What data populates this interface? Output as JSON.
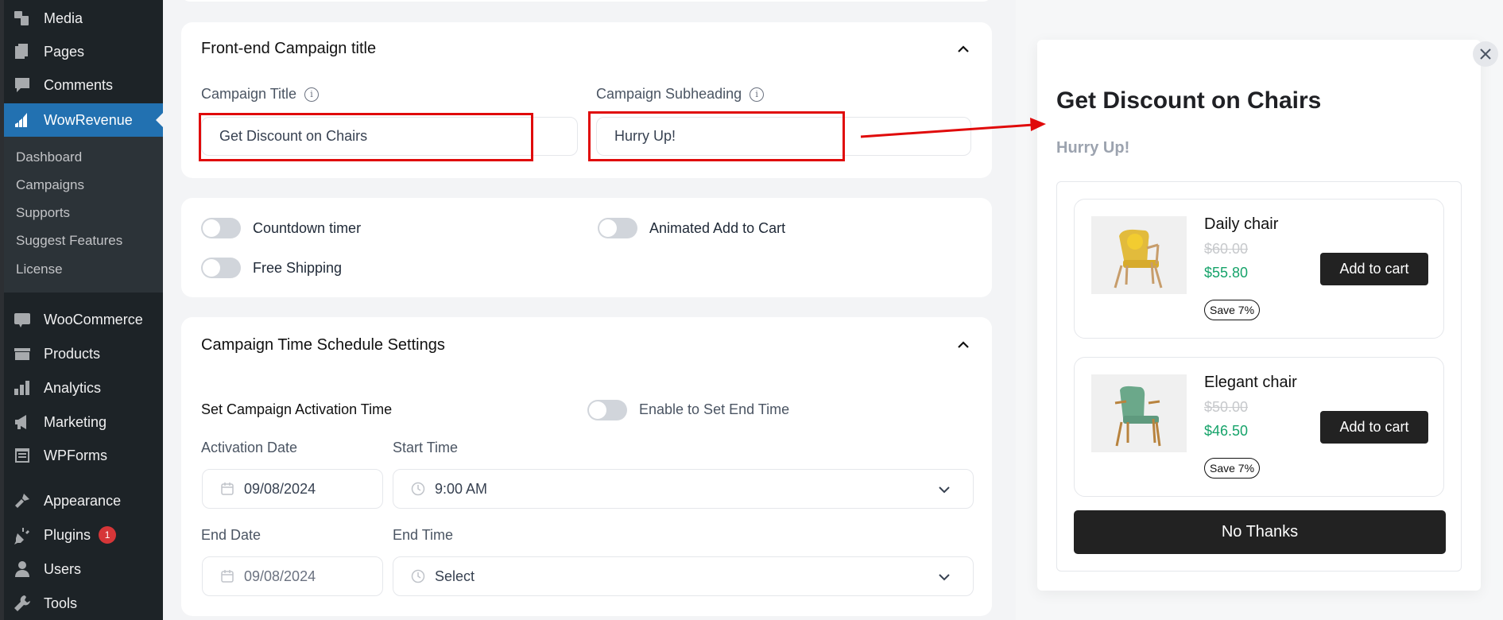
{
  "sidebar": {
    "items": [
      {
        "label": "Media",
        "icon": "media-icon"
      },
      {
        "label": "Pages",
        "icon": "pages-icon"
      },
      {
        "label": "Comments",
        "icon": "comments-icon"
      },
      {
        "label": "WowRevenue",
        "icon": "wowrevenue-icon",
        "active": true
      },
      {
        "label": "WooCommerce",
        "icon": "woocommerce-icon"
      },
      {
        "label": "Products",
        "icon": "products-icon"
      },
      {
        "label": "Analytics",
        "icon": "analytics-icon"
      },
      {
        "label": "Marketing",
        "icon": "marketing-icon"
      },
      {
        "label": "WPForms",
        "icon": "wpforms-icon"
      },
      {
        "label": "Appearance",
        "icon": "appearance-icon"
      },
      {
        "label": "Plugins",
        "icon": "plugins-icon",
        "badge": "1"
      },
      {
        "label": "Users",
        "icon": "users-icon"
      },
      {
        "label": "Tools",
        "icon": "tools-icon"
      }
    ],
    "submenu": [
      "Dashboard",
      "Campaigns",
      "Supports",
      "Suggest Features",
      "License"
    ],
    "accent": "#2271b1"
  },
  "title_section": {
    "heading": "Front-end Campaign title",
    "campaign_title_label": "Campaign Title",
    "campaign_title_value": "Get Discount on Chairs",
    "campaign_subheading_label": "Campaign Subheading",
    "campaign_subheading_value": "Hurry Up!"
  },
  "toggles": {
    "countdown_timer": "Countdown timer",
    "animated_add_to_cart": "Animated Add to Cart",
    "free_shipping": "Free Shipping"
  },
  "schedule": {
    "heading": "Campaign Time Schedule Settings",
    "activation_label": "Set Campaign Activation Time",
    "end_time_toggle": "Enable to Set End Time",
    "activation_date_label": "Activation Date",
    "activation_date_value": "09/08/2024",
    "start_time_label": "Start Time",
    "start_time_value": "9:00 AM",
    "end_date_label": "End Date",
    "end_date_value": "09/08/2024",
    "end_time_label": "End Time",
    "end_time_value": "Select"
  },
  "preview": {
    "title": "Get Discount on Chairs",
    "subtitle": "Hurry Up!",
    "products": [
      {
        "name": "Daily chair",
        "old_price": "$60.00",
        "new_price": "$55.80",
        "save": "Save 7%",
        "button": "Add to cart",
        "color": "#e2bb3c"
      },
      {
        "name": "Elegant chair",
        "old_price": "$50.00",
        "new_price": "$46.50",
        "save": "Save 7%",
        "button": "Add to cart",
        "color": "#6ba88a"
      }
    ],
    "no_thanks": "No Thanks",
    "price_color": "#16a36a"
  },
  "annotation_color": "#e00a0a"
}
